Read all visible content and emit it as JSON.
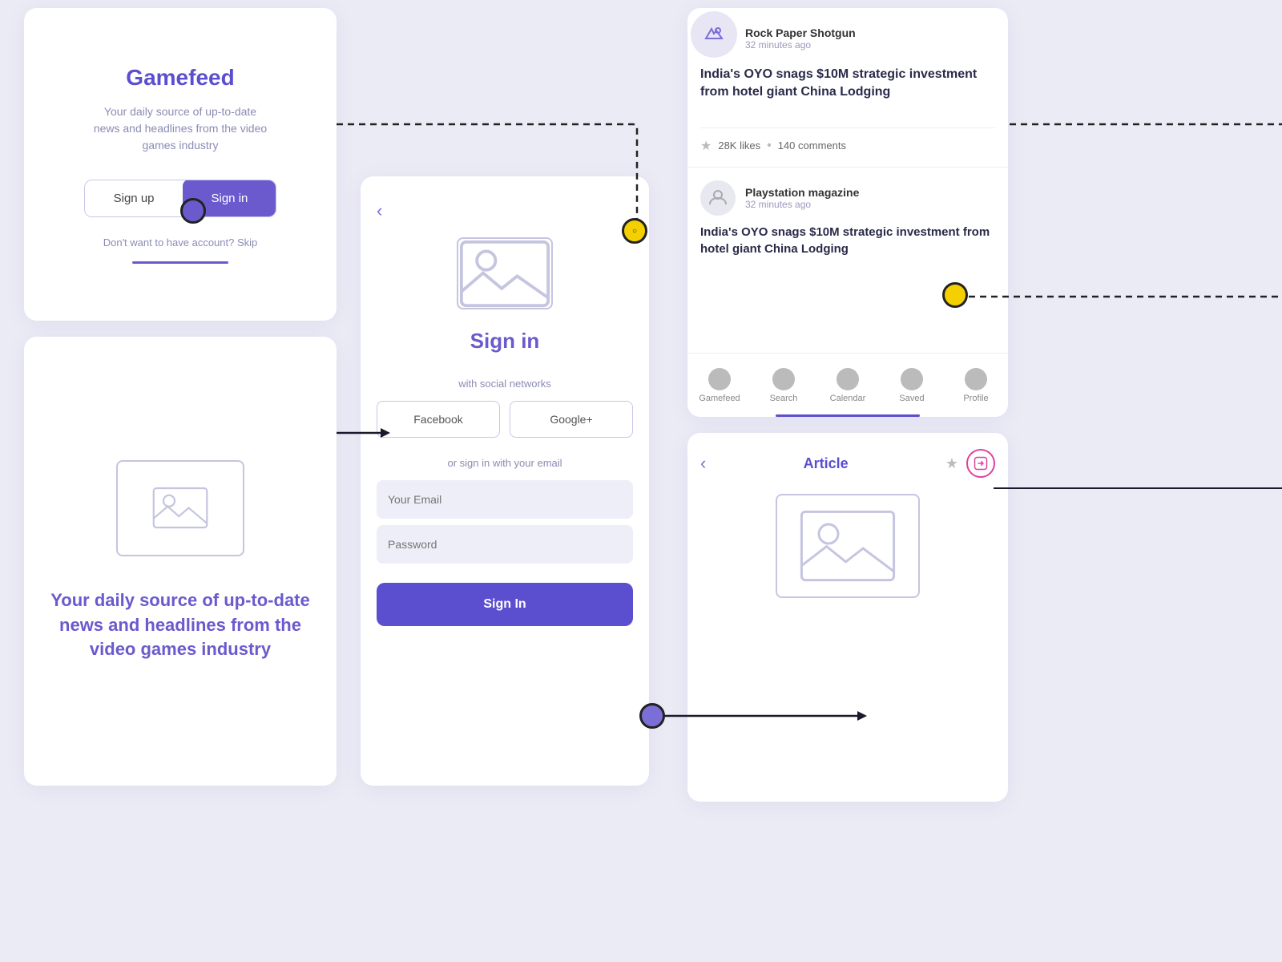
{
  "screens": {
    "gamefeed": {
      "title": "Gamefeed",
      "subtitle": "Your daily source of up-to-date\nnews and headlines from the video\ngames industry",
      "signup_label": "Sign up",
      "signin_label": "Sign in",
      "skip_text": "Don't want to have account? Skip"
    },
    "signin": {
      "back_icon": "‹",
      "title": "Sign in",
      "social_label": "with social networks",
      "facebook_label": "Facebook",
      "google_label": "Google+",
      "email_label": "or sign in with your email",
      "email_placeholder": "Your Email",
      "password_placeholder": "Password",
      "signin_button": "Sign In"
    },
    "newsfeed": {
      "articles": [
        {
          "source": "Rock Paper Shotgun",
          "time": "32 minutes ago",
          "title": "India's OYO snags $10M strategic investment from hotel giant China Lodging",
          "likes": "28K likes",
          "comments": "140 comments"
        },
        {
          "source": "Playstation magazine",
          "time": "32 minutes ago",
          "title": "India's OYO snags $10M strategic investment from hotel giant China Lodging"
        }
      ],
      "nav_items": [
        {
          "label": "Gamefeed"
        },
        {
          "label": "Search"
        },
        {
          "label": "Calendar"
        },
        {
          "label": "Saved"
        },
        {
          "label": "Profile"
        }
      ]
    },
    "article": {
      "back_icon": "‹",
      "title": "Article"
    },
    "bottom_left": {
      "text": "Your daily source of up-to-date news and headlines from the video games industry"
    }
  },
  "colors": {
    "purple": "#6a5acd",
    "light_purple": "#eeeef8",
    "text_gray": "#8b8bb5",
    "yellow": "#f5d000",
    "pink": "#e040a0"
  }
}
